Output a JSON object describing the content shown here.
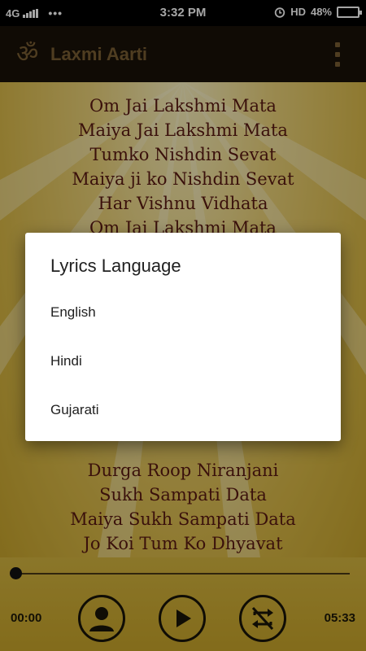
{
  "status_bar": {
    "network": "4G",
    "dots": "•••",
    "time": "3:32 PM",
    "hd": "HD",
    "battery": "48%"
  },
  "app_bar": {
    "icon": "om-icon",
    "om_glyph": "ॐ",
    "title": "Laxmi Aarti",
    "menu_icon": "overflow-menu-icon"
  },
  "lyrics": {
    "top_lines": [
      "Om Jai Lakshmi Mata",
      "Maiya Jai Lakshmi Mata",
      "Tumko Nishdin Sevat",
      "Maiya ji ko Nishdin Sevat",
      "Har Vishnu Vidhata",
      "Om Jai Lakshmi Mata"
    ],
    "bottom_lines": [
      "Durga Roop Niranjani",
      "Sukh Sampati Data",
      "Maiya Sukh Sampati Data",
      "Jo Koi Tum Ko Dhyavat"
    ]
  },
  "player": {
    "current_time": "00:00",
    "total_time": "05:33",
    "progress": 0,
    "controls": [
      "user-icon",
      "play-icon",
      "repeat-off-icon"
    ]
  },
  "dialog": {
    "title": "Lyrics Language",
    "options": [
      "English",
      "Hindi",
      "Gujarati"
    ]
  },
  "colors": {
    "app_bar_bg": "#1a1208",
    "app_bar_fg": "#7a5f34",
    "lyrics_text": "#5a1a12",
    "background_gold": "#d9b845"
  }
}
